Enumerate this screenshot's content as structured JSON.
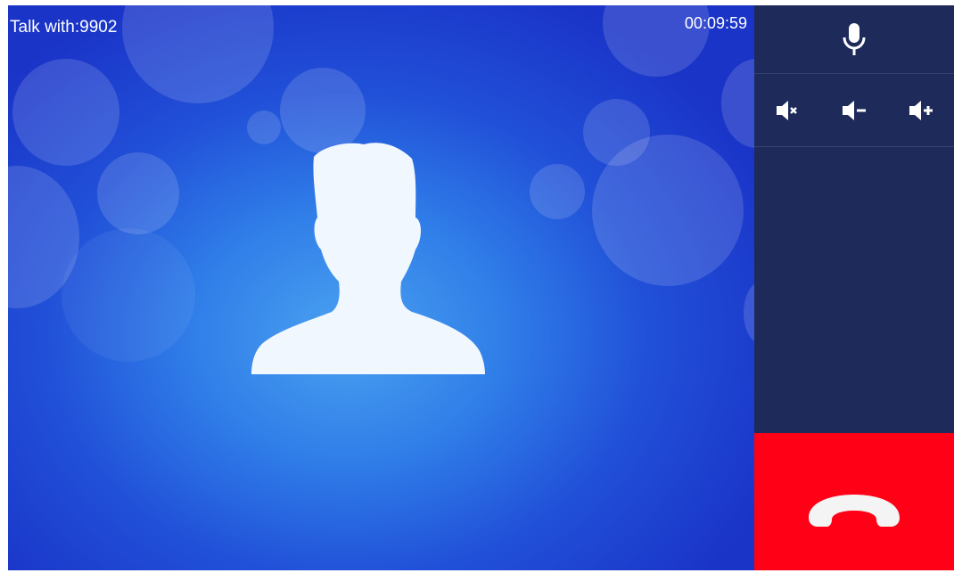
{
  "call": {
    "talk_with_label": "Talk with:9902",
    "duration": "00:09:59"
  },
  "icons": {
    "avatar": "person-silhouette-icon",
    "mic": "microphone-icon",
    "mute": "volume-mute-icon",
    "volume_down": "volume-down-icon",
    "volume_up": "volume-up-icon",
    "hangup": "phone-hangup-icon"
  },
  "colors": {
    "panel": "#1d2a5a",
    "hangup": "#ff0016",
    "background_blue": "#2f7ce8"
  }
}
